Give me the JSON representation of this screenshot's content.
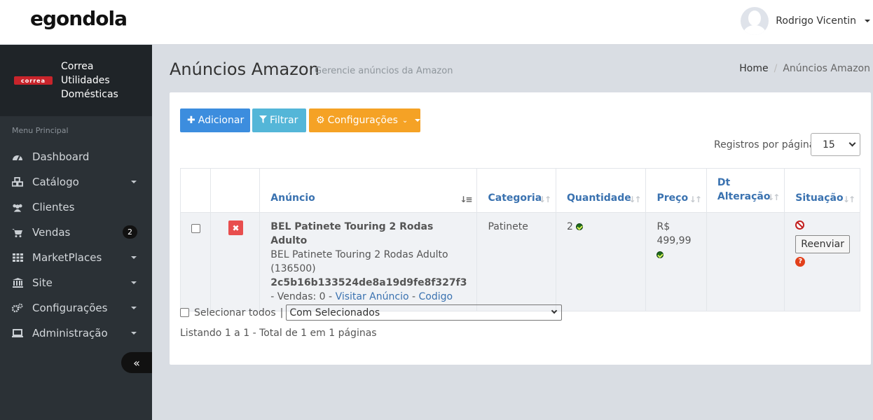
{
  "app": {
    "logo": "egondola"
  },
  "user": {
    "name": "Rodrigo Vicentin"
  },
  "brand": {
    "logo_text": "correa",
    "name": "Correa Utilidades Domésticas"
  },
  "sidebar": {
    "menu_title": "Menu Principal",
    "items": [
      {
        "label": "Dashboard",
        "icon": "dashboard-icon",
        "has_caret": false
      },
      {
        "label": "Catálogo",
        "icon": "cubes-icon",
        "has_caret": true
      },
      {
        "label": "Clientes",
        "icon": "users-icon",
        "has_caret": false
      },
      {
        "label": "Vendas",
        "icon": "cart-icon",
        "badge": "2"
      },
      {
        "label": "MarketPlaces",
        "icon": "grid-icon",
        "has_caret": true
      },
      {
        "label": "Site",
        "icon": "bank-icon",
        "has_caret": true
      },
      {
        "label": "Configurações",
        "icon": "gears-icon",
        "has_caret": true
      },
      {
        "label": "Administração",
        "icon": "laptop-icon",
        "has_caret": true
      }
    ],
    "collapse_glyph": "«"
  },
  "header": {
    "title": "Anúncios Amazon",
    "subtitle": "Gerencie anúncios da Amazon",
    "breadcrumb": [
      "Home",
      "Anúncios Amazon"
    ]
  },
  "toolbar": {
    "add_label": "Adicionar",
    "filter_label": "Filtrar",
    "config_label": "Configurações"
  },
  "per_page": {
    "label": "Registros por página",
    "value": "15"
  },
  "table": {
    "columns": [
      "",
      "",
      "Anúncio",
      "Categoria",
      "Quantidade",
      "Preço",
      "Dt Alteração",
      "Situação"
    ],
    "rows": [
      {
        "title": "BEL Patinete Touring 2 Rodas Adulto",
        "description": "BEL Patinete Touring 2 Rodas Adulto (136500)",
        "hash": "2c5b16b133524de8a19d9fe8f327f3",
        "sales": "- Vendas: 0 -",
        "visit_link": "Visitar Anúncio",
        "code_sep": "-",
        "code_link": "Codigo",
        "category": "Patinete",
        "quantity": "2",
        "price_currency": "R$",
        "price_value": "499,99",
        "date": "",
        "resend_label": "Reenviar"
      }
    ]
  },
  "bulk": {
    "select_all_label": "Selecionar todos",
    "separator": "|",
    "action_value": "Com Selecionados"
  },
  "footer": {
    "listing_text": "Listando 1 a 1 - Total de 1 em 1 páginas"
  },
  "colors": {
    "primary": "#3c8dde",
    "info": "#54b6d8",
    "warning": "#f5a225",
    "danger": "#e84e4e",
    "sidebar": "#2b3136"
  }
}
